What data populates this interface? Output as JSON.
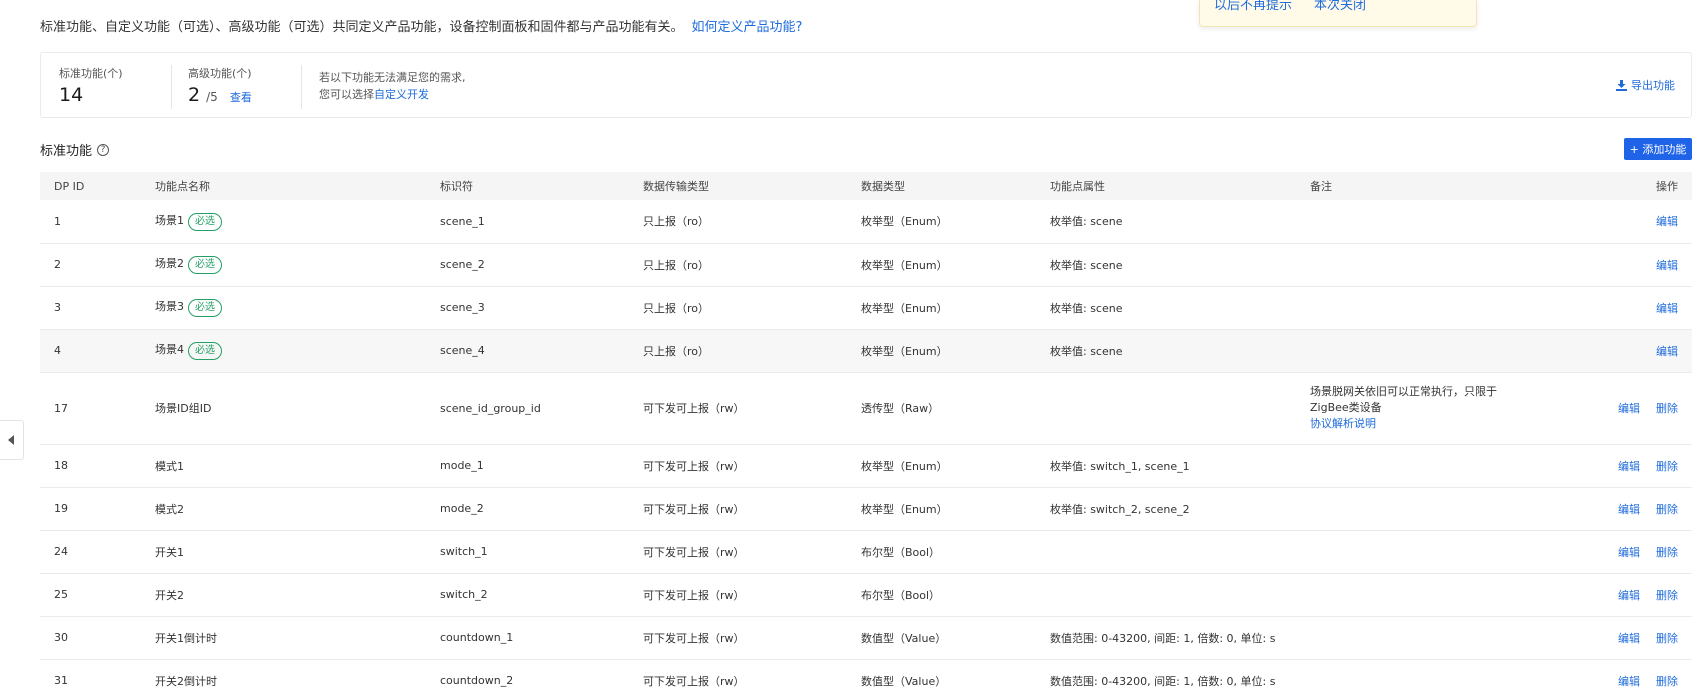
{
  "intro": {
    "text": "标准功能、自定义功能（可选）、高级功能（可选）共同定义产品功能，设备控制面板和固件都与产品功能有关。",
    "link": "如何定义产品功能?"
  },
  "popup": {
    "link1": "以后不再提示",
    "link2": "本次关闭"
  },
  "summary": {
    "standard_label": "标准功能(个)",
    "standard_value": "14",
    "advanced_label": "高级功能(个)",
    "advanced_value": "2",
    "advanced_total": "/5",
    "advanced_link": "查看",
    "note_line1": "若以下功能无法满足您的需求,",
    "note_line2_prefix": "您可以选择",
    "note_line2_link": "自定义开发",
    "export_label": "导出功能"
  },
  "section": {
    "title": "标准功能",
    "add_button": "+ 添加功能"
  },
  "table": {
    "headers": [
      "DP ID",
      "功能点名称",
      "标识符",
      "数据传输类型",
      "数据类型",
      "功能点属性",
      "备注",
      "操作"
    ],
    "required_tag": "必选",
    "edit_label": "编辑",
    "delete_label": "删除",
    "rows": [
      {
        "id": "1",
        "name": "场景1",
        "required": true,
        "identifier": "scene_1",
        "transfer": "只上报（ro）",
        "dtype": "枚举型（Enum）",
        "attr": "枚举值: scene",
        "remark": "",
        "remark_link": "",
        "deletable": false
      },
      {
        "id": "2",
        "name": "场景2",
        "required": true,
        "identifier": "scene_2",
        "transfer": "只上报（ro）",
        "dtype": "枚举型（Enum）",
        "attr": "枚举值: scene",
        "remark": "",
        "remark_link": "",
        "deletable": false
      },
      {
        "id": "3",
        "name": "场景3",
        "required": true,
        "identifier": "scene_3",
        "transfer": "只上报（ro）",
        "dtype": "枚举型（Enum）",
        "attr": "枚举值: scene",
        "remark": "",
        "remark_link": "",
        "deletable": false
      },
      {
        "id": "4",
        "name": "场景4",
        "required": true,
        "identifier": "scene_4",
        "transfer": "只上报（ro）",
        "dtype": "枚举型（Enum）",
        "attr": "枚举值: scene",
        "remark": "",
        "remark_link": "",
        "deletable": false
      },
      {
        "id": "17",
        "name": "场景ID组ID",
        "required": false,
        "identifier": "scene_id_group_id",
        "transfer": "可下发可上报（rw）",
        "dtype": "透传型（Raw）",
        "attr": "",
        "remark": "场景脱网关依旧可以正常执行，只限于ZigBee类设备",
        "remark_link": "协议解析说明",
        "deletable": true
      },
      {
        "id": "18",
        "name": "模式1",
        "required": false,
        "identifier": "mode_1",
        "transfer": "可下发可上报（rw）",
        "dtype": "枚举型（Enum）",
        "attr": "枚举值: switch_1, scene_1",
        "remark": "",
        "remark_link": "",
        "deletable": true
      },
      {
        "id": "19",
        "name": "模式2",
        "required": false,
        "identifier": "mode_2",
        "transfer": "可下发可上报（rw）",
        "dtype": "枚举型（Enum）",
        "attr": "枚举值: switch_2, scene_2",
        "remark": "",
        "remark_link": "",
        "deletable": true
      },
      {
        "id": "24",
        "name": "开关1",
        "required": false,
        "identifier": "switch_1",
        "transfer": "可下发可上报（rw）",
        "dtype": "布尔型（Bool）",
        "attr": "",
        "remark": "",
        "remark_link": "",
        "deletable": true
      },
      {
        "id": "25",
        "name": "开关2",
        "required": false,
        "identifier": "switch_2",
        "transfer": "可下发可上报（rw）",
        "dtype": "布尔型（Bool）",
        "attr": "",
        "remark": "",
        "remark_link": "",
        "deletable": true
      },
      {
        "id": "30",
        "name": "开关1倒计时",
        "required": false,
        "identifier": "countdown_1",
        "transfer": "可下发可上报（rw）",
        "dtype": "数值型（Value）",
        "attr": "数值范围: 0-43200, 间距: 1, 倍数: 0, 单位: s",
        "remark": "",
        "remark_link": "",
        "deletable": true
      },
      {
        "id": "31",
        "name": "开关2倒计时",
        "required": false,
        "identifier": "countdown_2",
        "transfer": "可下发可上报（rw）",
        "dtype": "数值型（Value）",
        "attr": "数值范围: 0-43200, 间距: 1, 倍数: 0, 单位: s",
        "remark": "",
        "remark_link": "",
        "deletable": true
      }
    ]
  },
  "icons": {
    "help": "question-circle-icon",
    "export": "download-icon",
    "side_toggle": "caret-left-icon"
  },
  "colors": {
    "link": "#1e6bdc",
    "primary": "#1e63e8",
    "required_tag": "#24a065"
  }
}
